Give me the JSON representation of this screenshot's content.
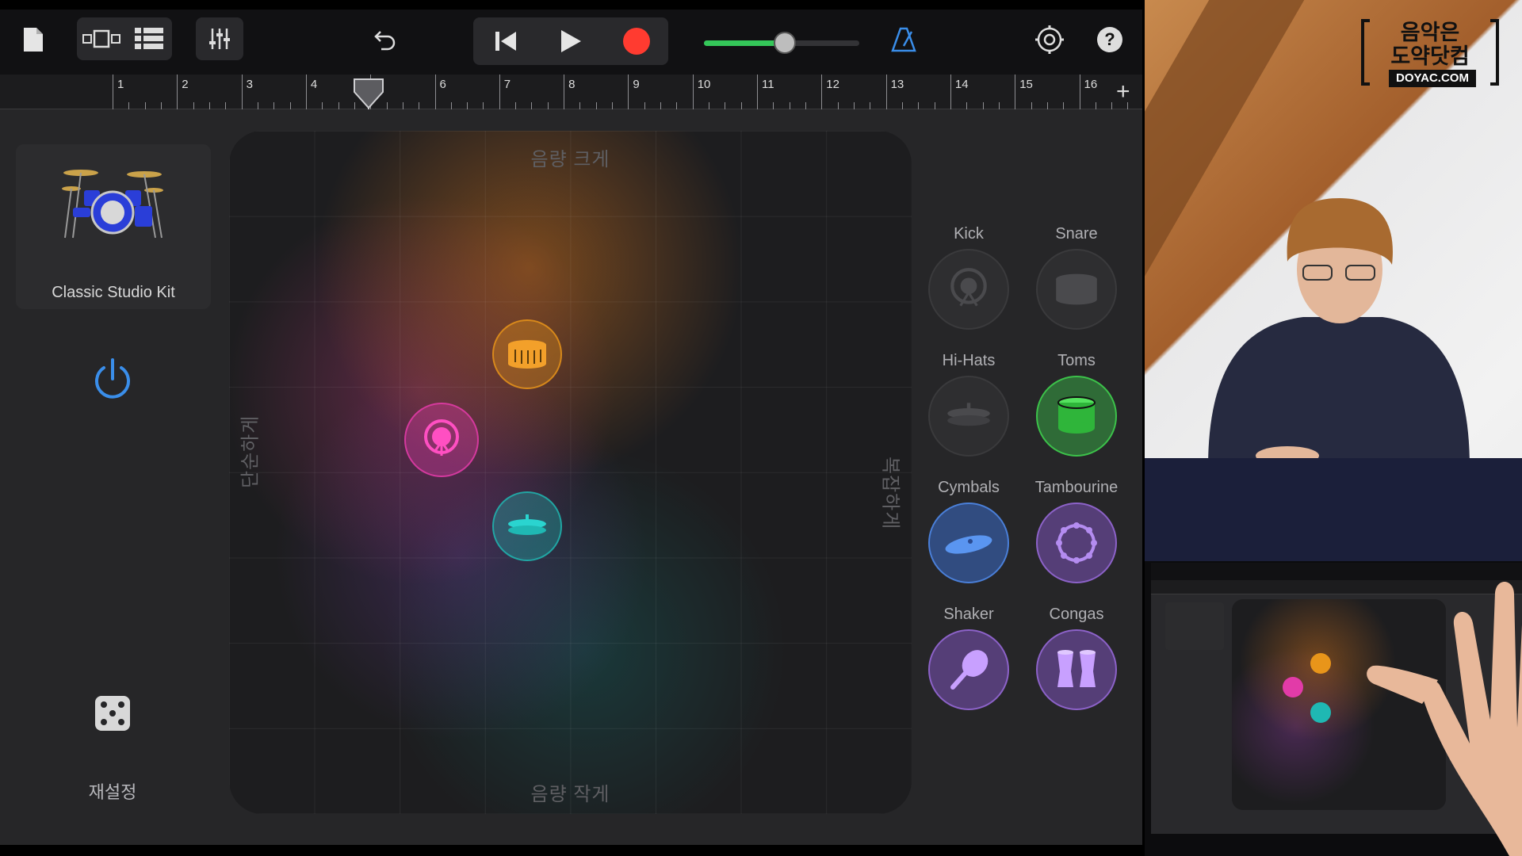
{
  "toolbar": {
    "icons": [
      "document-icon",
      "track-view-icon",
      "tracks-list-icon",
      "mixer-icon",
      "undo-icon",
      "rewind-icon",
      "play-icon",
      "record-icon",
      "metronome-icon",
      "settings-icon",
      "help-icon"
    ],
    "help_label": "?",
    "accent_green": "#34c759",
    "record_color": "#ff3b30",
    "metronome_color": "#3a8eea"
  },
  "volume": {
    "level": 0.52
  },
  "ruler": {
    "bars": [
      "1",
      "2",
      "3",
      "4",
      "5",
      "6",
      "7",
      "8",
      "9",
      "10",
      "11",
      "12",
      "13",
      "14",
      "15",
      "16"
    ],
    "playhead_bar": "5",
    "add_label": "+"
  },
  "kit": {
    "name": "Classic Studio Kit"
  },
  "power": {
    "color": "#3a8eea"
  },
  "reset": {
    "label": "재설정"
  },
  "pad": {
    "axis_top": "음량 크게",
    "axis_bottom": "음량 작게",
    "axis_left": "단순하게",
    "axis_right": "복잡하게",
    "pucks": [
      {
        "name": "snare-puck",
        "color": "#e8951a"
      },
      {
        "name": "kick-puck",
        "color": "#e23ba8"
      },
      {
        "name": "hihat-puck",
        "color": "#1fb8b3"
      }
    ]
  },
  "instruments": [
    {
      "label": "Kick",
      "active": false
    },
    {
      "label": "Snare",
      "active": false
    },
    {
      "label": "Hi-Hats",
      "active": false
    },
    {
      "label": "Toms",
      "active": true,
      "color": "#3cc24a"
    },
    {
      "label": "Cymbals",
      "active": true,
      "color": "#3a6cc8"
    },
    {
      "label": "Tambourine",
      "active": true,
      "color": "#7c52b8"
    },
    {
      "label": "Shaker",
      "active": true,
      "color": "#7c52b8"
    },
    {
      "label": "Congas",
      "active": true,
      "color": "#7c52b8"
    }
  ],
  "logo": {
    "line1": "음악은",
    "line2": "도약닷컴",
    "url": "DOYAC.COM"
  }
}
